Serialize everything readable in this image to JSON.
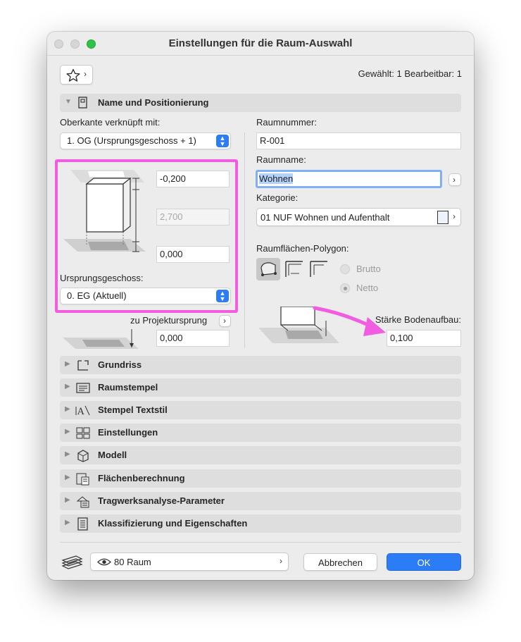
{
  "window": {
    "title": "Einstellungen für die Raum-Auswahl"
  },
  "top": {
    "selection_status": "Gewählt: 1 Bearbeitbar: 1"
  },
  "name_section": {
    "title": "Name und Positionierung",
    "top_link_label": "Oberkante verknüpft mit:",
    "top_link_value": "1. OG (Ursprungsgeschoss + 1)",
    "offset_top": "-0,200",
    "height": "2,700",
    "offset_bottom": "0,000",
    "home_story_label": "Ursprungsgeschoss:",
    "home_story_value": "0. EG (Aktuell)",
    "project_origin_label": "zu Projektursprung",
    "project_origin_value": "0,000",
    "room_number_label": "Raumnummer:",
    "room_number_value": "R-001",
    "room_name_label": "Raumname:",
    "room_name_value": "Wohnen",
    "category_label": "Kategorie:",
    "category_value": "01 NUF Wohnen und Aufenthalt",
    "polygon_label": "Raumflächen-Polygon:",
    "radio_gross": "Brutto",
    "radio_net": "Netto",
    "floor_thickness_label": "Stärke Bodenaufbau:",
    "floor_thickness_value": "0,100"
  },
  "sections": [
    {
      "label": "Grundriss",
      "icon": "floorplan-icon"
    },
    {
      "label": "Raumstempel",
      "icon": "zone-stamp-icon"
    },
    {
      "label": "Stempel Textstil",
      "icon": "text-style-icon"
    },
    {
      "label": "Einstellungen",
      "icon": "settings-grid-icon"
    },
    {
      "label": "Modell",
      "icon": "model-cube-icon"
    },
    {
      "label": "Flächenberechnung",
      "icon": "area-calc-icon"
    },
    {
      "label": "Tragwerksanalyse-Parameter",
      "icon": "structural-icon"
    },
    {
      "label": "Klassifizierung und Eigenschaften",
      "icon": "classification-icon"
    }
  ],
  "bottom": {
    "layer_value": "80 Raum",
    "cancel_label": "Abbrechen",
    "ok_label": "OK"
  },
  "annotation": {
    "highlight_color": "#f25ce0"
  }
}
